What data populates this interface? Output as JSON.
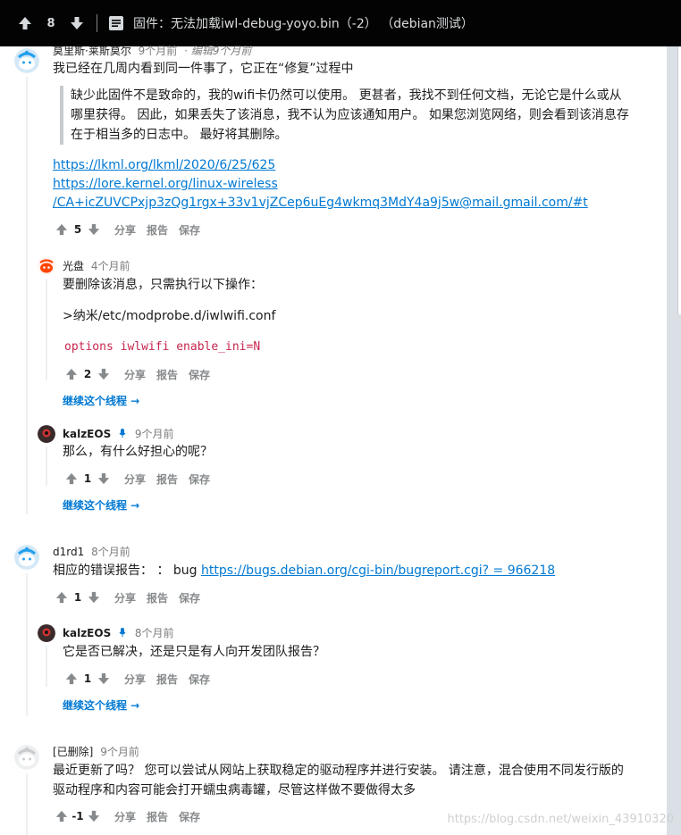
{
  "post": {
    "votes": "8",
    "title": "固件：无法加载iwl-debug-yoyo.bin（-2） （debian测试）"
  },
  "comments": [
    {
      "author": "莫里斯·莱斯莫尔",
      "time": "9个月前",
      "edited": "编辑9个月前",
      "line1": "我已经在几周内看到同一件事了，它正在“修复”过程中",
      "quote": [
        "缺少此固件不是致命的，我的wifi卡仍然可以使用。 更甚者，我找不到任何文档，无论它是什么或从",
        "哪里获得。 因此，如果丢失了该消息，我不认为应该通知用户。 如果您浏览网络，则会看到该消息存",
        "在于相当多的日志中。 最好将其删除。"
      ],
      "links": [
        "https://lkml.org/lkml/2020/6/25/625",
        "https://lore.kernel.org/linux-wireless",
        "/CA+icZUVCPxjp3zQg1rgx+33v1vjZCep6uEg4wkmq3MdY4a9j5w@mail.gmail.com/#t"
      ],
      "votes": "5"
    },
    {
      "author": "光盘",
      "time": "4个月前",
      "line1": "要删除该消息，只需执行以下操作：",
      "line2": ">纳米/etc/modprobe.d/iwlwifi.conf",
      "code": "options iwlwifi enable_ini=N",
      "votes": "2"
    },
    {
      "author": "kalzEOS",
      "time": "9个月前",
      "line1": "那么，有什么好担心的呢？",
      "votes": "1"
    },
    {
      "author": "d1rd1",
      "time": "8个月前",
      "line1_prefix": "相应的错误报告：  ：  bug ",
      "line1_link": "https://bugs.debian.org/cgi-bin/bugreport.cgi?  = 966218",
      "votes": "1"
    },
    {
      "author": "kalzEOS",
      "time": "8个月前",
      "line1": "它是否已解决，还是只是有人向开发团队报告？",
      "votes": "1"
    },
    {
      "author": "[已删除]",
      "time": "9个月前",
      "line1": "最近更新了吗？  您可以尝试从网站上获取稳定的驱动程序并进行安装。 请注意，混合使用不同发行版的",
      "line2": "驱动程序和内容可能会打开蠕虫病毒罐，尽管这样做不要做得太多",
      "votes": "-1"
    }
  ],
  "actions": {
    "share": "分享",
    "report": "报告",
    "save": "保存",
    "continue_thread": "继续这个线程 →"
  },
  "watermark": "https://blog.csdn.net/weixin_43910320",
  "colors": {
    "link": "#0079d3",
    "code": "#c7254e",
    "topbar": "#030303"
  }
}
